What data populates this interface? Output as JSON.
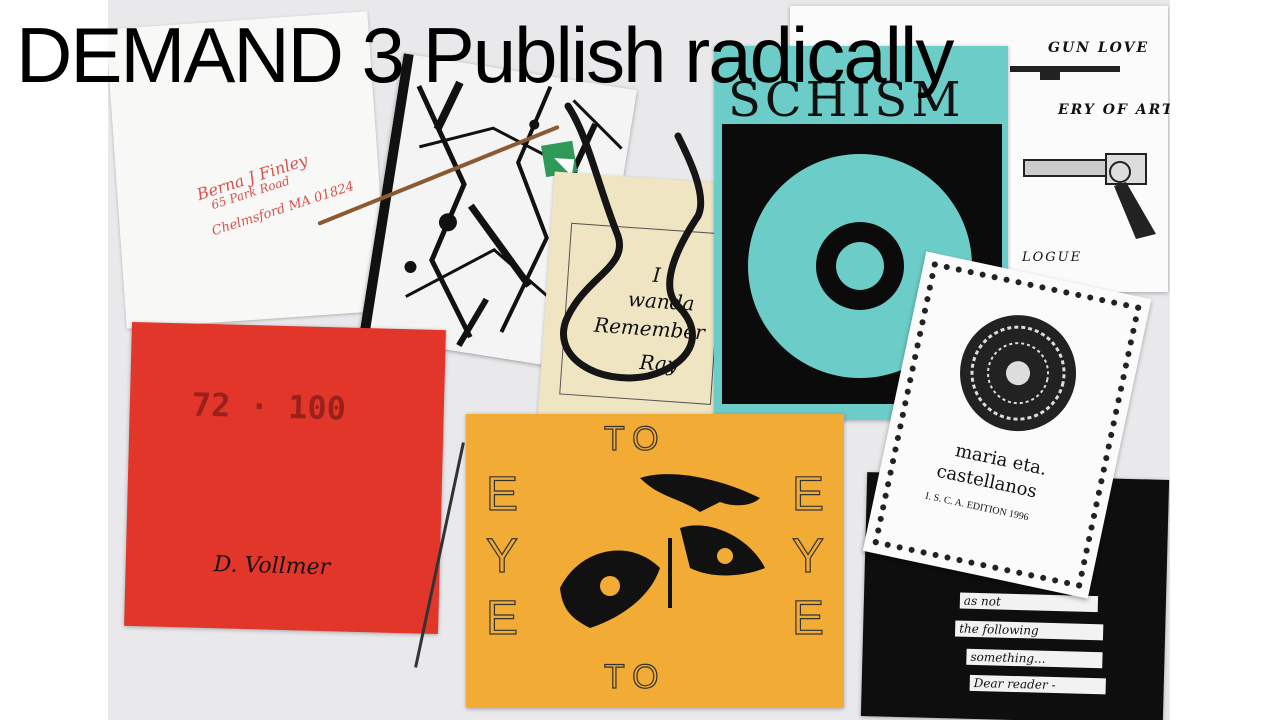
{
  "slide": {
    "title": "DEMAND 3 Publish radically"
  },
  "zines": {
    "envelope": {
      "line1": "Berna J Finley",
      "line2": "65 Park Road",
      "line3": "Chelmsford MA 01824"
    },
    "splatter": {},
    "remember": {
      "lines": [
        "I",
        "wanda",
        "Remember",
        "Ray"
      ]
    },
    "schism": {
      "title": "SCHISM"
    },
    "gunlove": {
      "heading": "GUN LOVE",
      "subheading": "ERY OF ART",
      "footer": "LOGUE"
    },
    "red_book": {
      "number": "72 · 100",
      "signature": "D. Vollmer"
    },
    "eye_to_eye": {
      "to_top": "TO",
      "to_bottom": "TO",
      "eye_left": "EYE",
      "eye_right": "EYE"
    },
    "aztec": {
      "name_line1": "maria eta.",
      "name_line2": "castellanos",
      "edition": "I. S. C. A. EDITION 1996"
    },
    "black_notes": {
      "strips": [
        "as not",
        "the following",
        "something...",
        "Dear reader -"
      ]
    }
  },
  "colors": {
    "orange_cover": "#f2ab35",
    "red_cover": "#e2362b",
    "teal_cover": "#6ccdc8",
    "background": "#e9e9ec"
  }
}
